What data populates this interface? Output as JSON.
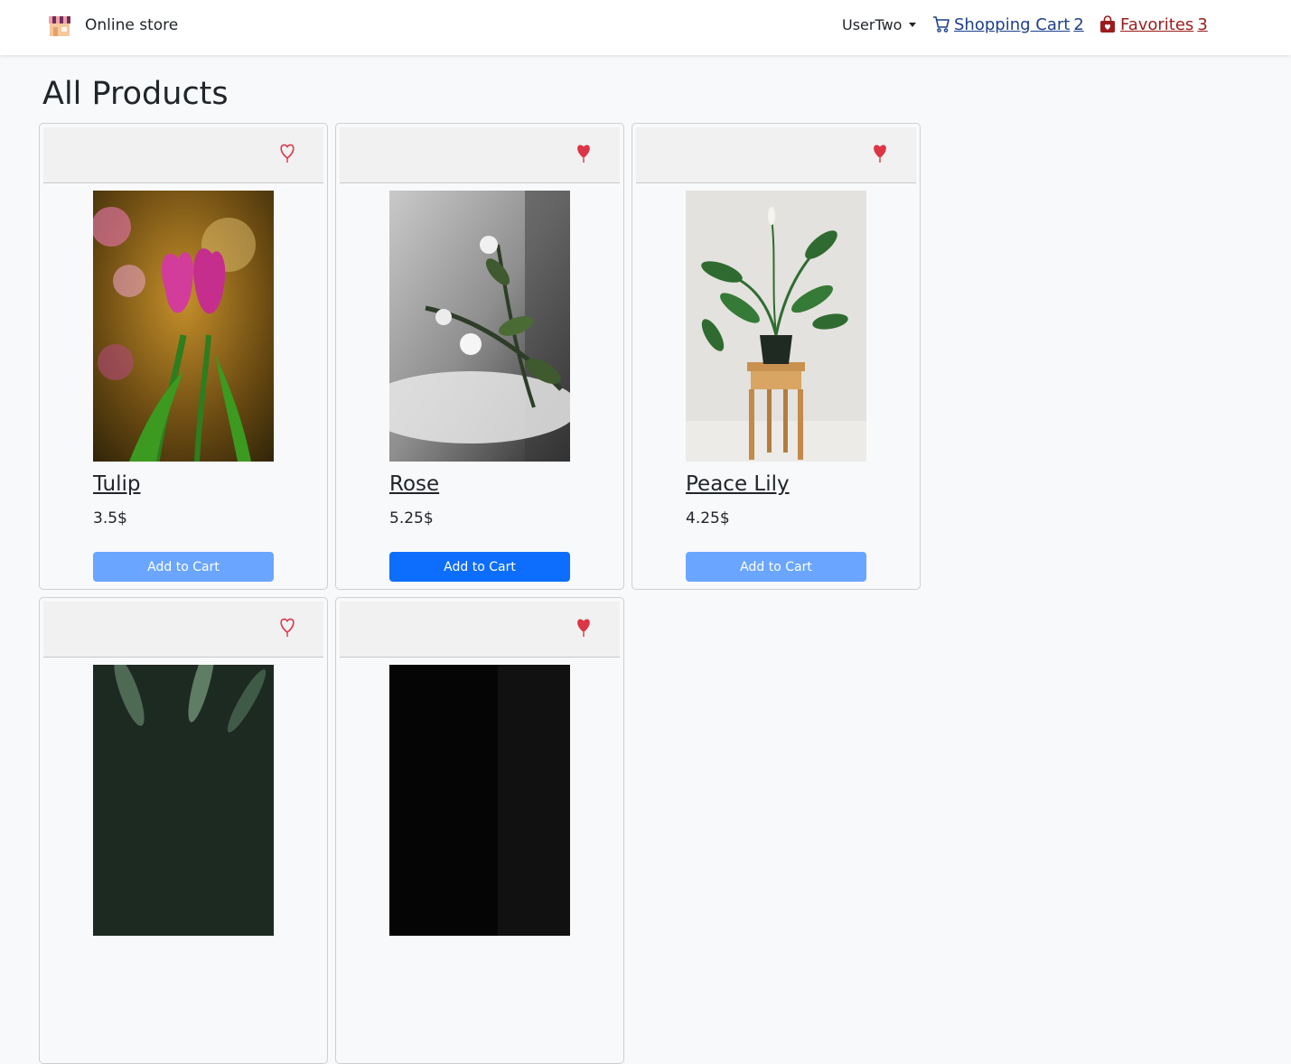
{
  "navbar": {
    "brand": "Online store",
    "user": "UserTwo",
    "cart": {
      "label": "Shopping Cart",
      "count": "2"
    },
    "favorites": {
      "label": "Favorites",
      "count": "3"
    }
  },
  "page": {
    "title": "All Products"
  },
  "products": [
    {
      "name": "Tulip",
      "price": "3.5$",
      "favorited": false,
      "cart_label": "Add to Cart",
      "cart_state": "light"
    },
    {
      "name": "Rose",
      "price": "5.25$",
      "favorited": true,
      "cart_label": "Add to Cart",
      "cart_state": "solid"
    },
    {
      "name": "Peace Lily",
      "price": "4.25$",
      "favorited": true,
      "cart_label": "Add to Cart",
      "cart_state": "light"
    },
    {
      "name": "",
      "price": "",
      "favorited": false,
      "cart_label": "",
      "cart_state": "light"
    },
    {
      "name": "",
      "price": "",
      "favorited": true,
      "cart_label": "",
      "cart_state": "light"
    }
  ],
  "colors": {
    "heart": "#dc3545",
    "cart_link": "#1d3f8a",
    "favorites_link": "#9b1c1c",
    "button_primary": "#0d6efd",
    "button_light": "#6aa6ff"
  }
}
